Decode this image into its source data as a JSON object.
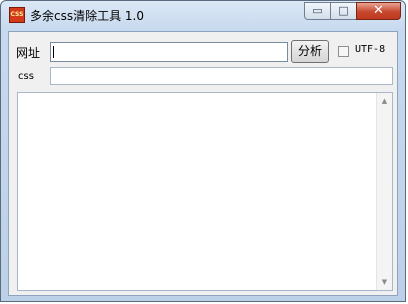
{
  "window": {
    "title": "多余css清除工具 1.0",
    "icon_text": "CSS",
    "controls": {
      "minimize": "▭",
      "maximize": "□",
      "close": "✕"
    }
  },
  "form": {
    "url_label": "网址",
    "url_value": "",
    "analyze_button": "分析",
    "utf8_label": "UTF-8",
    "utf8_checked": false,
    "css_label": "css",
    "css_value": ""
  },
  "output": {
    "text": "",
    "scroll_up_glyph": "▲",
    "scroll_down_glyph": "▼"
  }
}
